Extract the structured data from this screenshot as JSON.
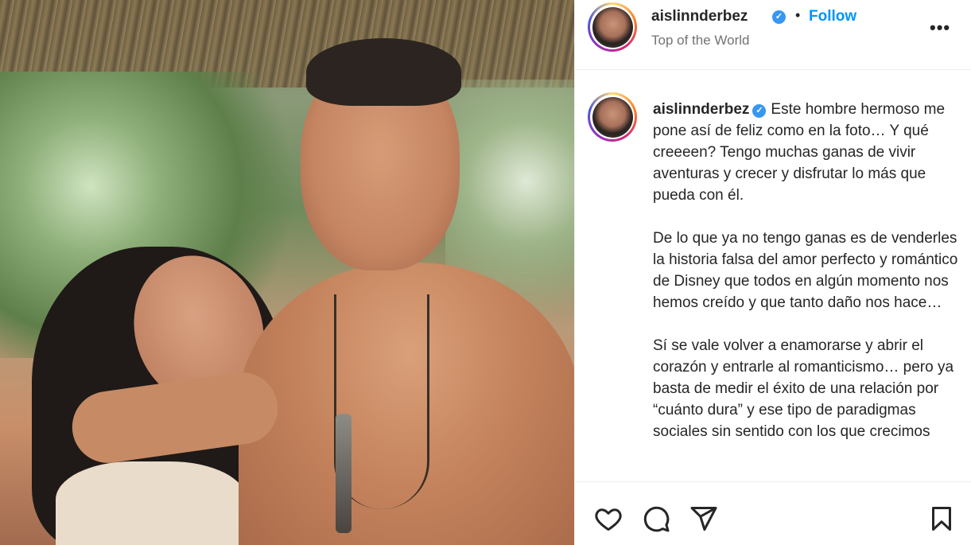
{
  "post": {
    "author": {
      "username": "aislinnderbez",
      "verified_icon": "verified-badge-icon",
      "location": "Top of the World"
    },
    "header": {
      "separator": "•",
      "follow_label": "Follow",
      "more_label": "•••"
    },
    "caption": {
      "text": "Este hombre hermoso me pone así de feliz como en la foto… Y qué creeeen? Tengo muchas ganas de vivir aventuras y crecer y disfrutar lo más que pueda con él.\n\nDe lo que ya no tengo ganas es de venderles la historia falsa del amor perfecto y romántico de Disney que todos en algún momento nos hemos creído y que tanto daño nos hace…\n\nSí se vale volver a enamorarse y abrir el corazón y entrarle al romanticismo… pero ya basta de medir el éxito de una relación por “cuánto dura” y ese tipo de paradigmas sociales sin sentido con los que crecimos"
    },
    "actions": {
      "like_icon": "heart-icon",
      "comment_icon": "comment-icon",
      "share_icon": "send-icon",
      "save_icon": "bookmark-icon"
    }
  },
  "colors": {
    "follow_blue": "#0095f6",
    "verified_blue": "#3897f0",
    "text": "#262626",
    "secondary_text": "#737373",
    "divider": "#efefef"
  }
}
